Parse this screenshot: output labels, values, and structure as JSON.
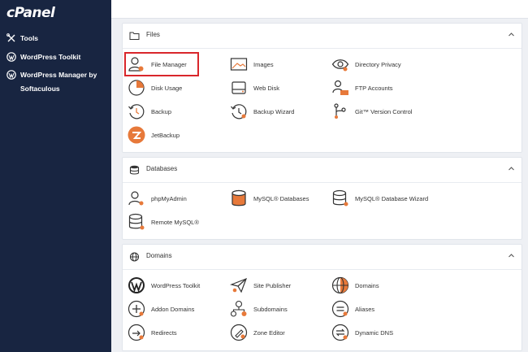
{
  "brand": {
    "logo_text": "cPanel"
  },
  "sidebar": {
    "items": [
      {
        "label": "Tools",
        "icon": "tools-icon"
      },
      {
        "label": "WordPress Toolkit",
        "icon": "wordpress-icon"
      },
      {
        "label": "WordPress Manager by Softaculous",
        "icon": "wordpress-icon"
      }
    ]
  },
  "sections": {
    "files": {
      "title": "Files",
      "items": {
        "file_manager": "File Manager",
        "images": "Images",
        "directory_privacy": "Directory Privacy",
        "disk_usage": "Disk Usage",
        "web_disk": "Web Disk",
        "ftp_accounts": "FTP Accounts",
        "backup": "Backup",
        "backup_wizard": "Backup Wizard",
        "git_version_control": "Git™ Version Control",
        "jetbackup": "JetBackup"
      }
    },
    "databases": {
      "title": "Databases",
      "items": {
        "phpmyadmin": "phpMyAdmin",
        "mysql_databases": "MySQL® Databases",
        "mysql_database_wizard": "MySQL® Database Wizard",
        "remote_mysql": "Remote MySQL®"
      }
    },
    "domains": {
      "title": "Domains",
      "items": {
        "wordpress_toolkit": "WordPress Toolkit",
        "site_publisher": "Site Publisher",
        "domains": "Domains",
        "addon_domains": "Addon Domains",
        "subdomains": "Subdomains",
        "aliases": "Aliases",
        "redirects": "Redirects",
        "zone_editor": "Zone Editor",
        "dynamic_dns": "Dynamic DNS"
      }
    }
  },
  "colors": {
    "sidebar_bg": "#182541",
    "accent_orange": "#e7793a",
    "highlight_red": "#d9262b"
  }
}
